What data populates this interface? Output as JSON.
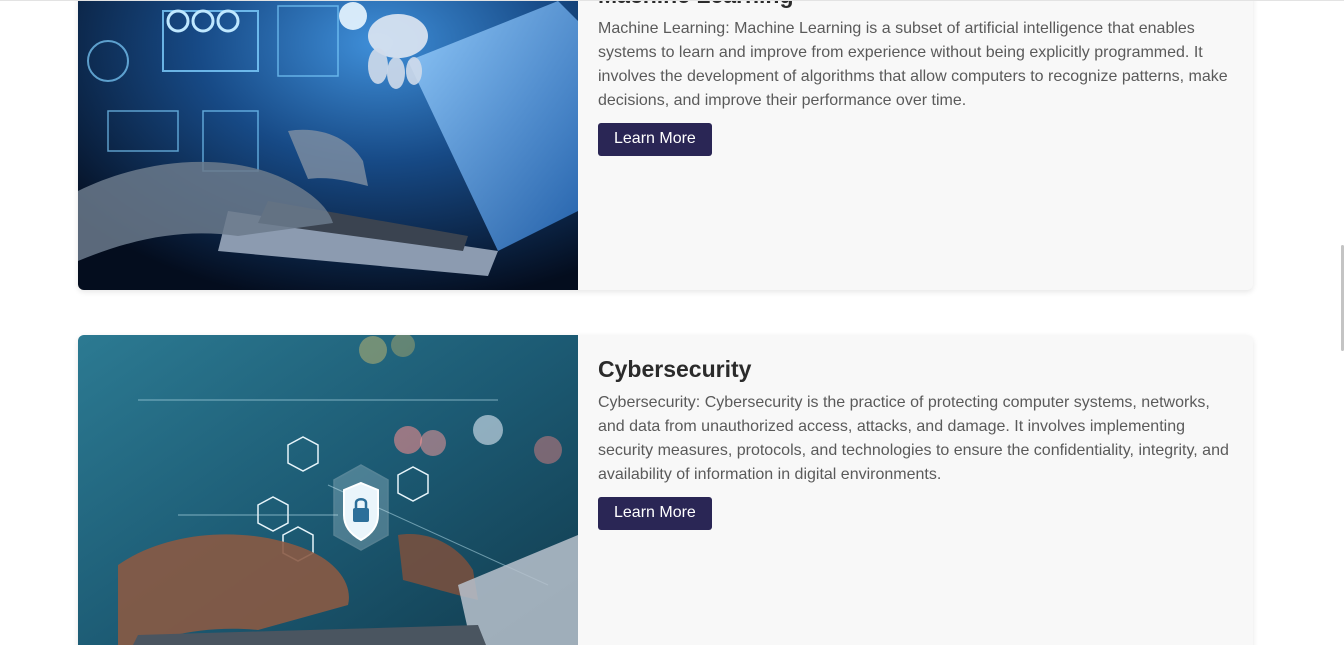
{
  "cards": [
    {
      "title": "Machine Learning",
      "description": "Machine Learning: Machine Learning is a subset of artificial intelligence that enables systems to learn and improve from experience without being explicitly programmed. It involves the development of algorithms that allow computers to recognize patterns, make decisions, and improve their performance over time.",
      "button_label": "Learn More",
      "image_subject": "hands-typing-laptop-with-robot-hand-and-holographic-dashboards"
    },
    {
      "title": "Cybersecurity",
      "description": "Cybersecurity: Cybersecurity is the practice of protecting computer systems, networks, and data from unauthorized access, attacks, and damage. It involves implementing security measures, protocols, and technologies to ensure the confidentiality, integrity, and availability of information in digital environments.",
      "button_label": "Learn More",
      "image_subject": "hands-typing-laptop-with-shield-lock-and-security-icons"
    }
  ],
  "colors": {
    "button_bg": "#2a2655",
    "card_bg": "#f8f8f8",
    "title_text": "#2b2b2b",
    "body_text": "#5a5a5a"
  }
}
